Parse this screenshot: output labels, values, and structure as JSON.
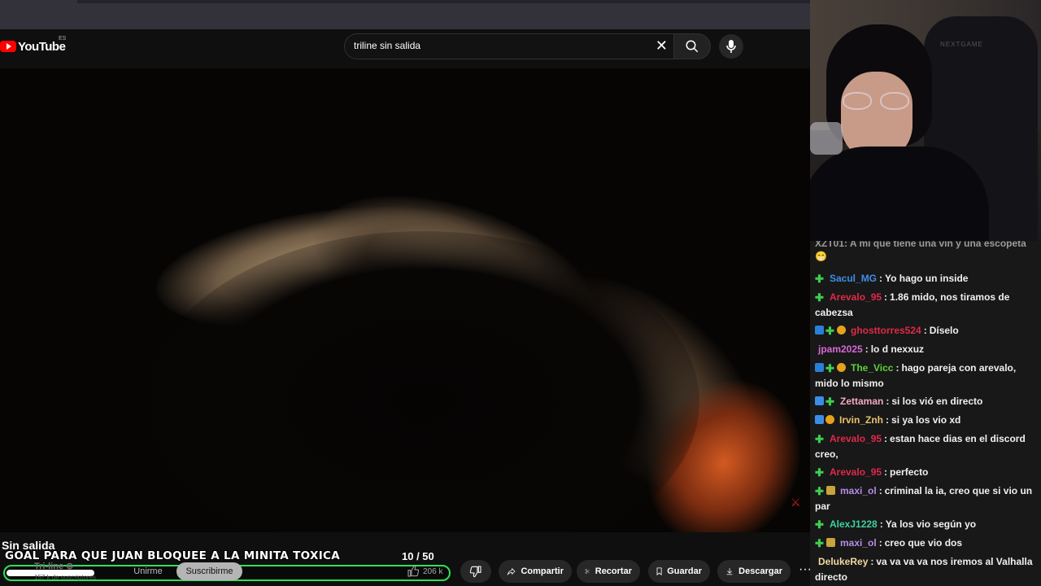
{
  "header": {
    "logo_text": "YouTube",
    "country_code": "ES",
    "search_value": "triline sin salida"
  },
  "video": {
    "title": "Sin salida"
  },
  "channel": {
    "name": "Tri-line ⊚",
    "subscribers": "157 k de suscriptores",
    "join_label": "Unirme",
    "subscribe_label": "Suscribirme"
  },
  "actions": {
    "likes": "206 k",
    "share": "Compartir",
    "clip": "Recortar",
    "save": "Guardar",
    "download": "Descargar",
    "more": "···"
  },
  "goal": {
    "text": "GOAL PARA QUE JUAN BLOQUEE A LA MINITA TOXICA",
    "count": "10 / 50",
    "current": 10,
    "target": 50
  },
  "webcam": {
    "chair_logo": "NEXTGAME"
  },
  "chat": {
    "cut_text": "XZT01: A mi que tiene una vin y una escopeta",
    "cut_emoji": "😁",
    "messages": [
      {
        "badges": [
          "plus"
        ],
        "user": "Sacul_MG",
        "color": "#3f8ee8",
        "text": "Yo hago un inside"
      },
      {
        "badges": [
          "plus"
        ],
        "user": "Arevalo_95",
        "color": "#e0294a",
        "text": "1.86 mido, nos tiramos de cabezsa"
      },
      {
        "badges": [
          "cube",
          "plus",
          "gold"
        ],
        "user": "ghosttorres524",
        "color": "#e0294a",
        "text": "Díselo"
      },
      {
        "badges": [],
        "user": "jpam2025",
        "color": "#d46ad8",
        "text": "lo d nexxuz"
      },
      {
        "badges": [
          "cube",
          "plus",
          "gold"
        ],
        "user": "The_Vicc",
        "color": "#5fd13a",
        "text": "hago pareja con arevalo, mido lo mismo"
      },
      {
        "badges": [
          "arrow",
          "plus"
        ],
        "user": "Zettaman",
        "color": "#f3a8c4",
        "text": "si los vió en directo"
      },
      {
        "badges": [
          "arrow",
          "gold"
        ],
        "user": "Irvin_Znh",
        "color": "#e8c36a",
        "text": "si ya los vio xd"
      },
      {
        "badges": [
          "plus"
        ],
        "user": "Arevalo_95",
        "color": "#e0294a",
        "text": "estan hace dias en el discord creo,"
      },
      {
        "badges": [
          "plus"
        ],
        "user": "Arevalo_95",
        "color": "#e0294a",
        "text": "perfecto"
      },
      {
        "badges": [
          "plus",
          "crown"
        ],
        "user": "maxi_ol",
        "color": "#b58ce8",
        "text": "criminal la ia, creo que si vio un par"
      },
      {
        "badges": [
          "plus"
        ],
        "user": "AlexJ1228",
        "color": "#3fd0a0",
        "text": "Ya los vio según yo"
      },
      {
        "badges": [
          "plus",
          "crown"
        ],
        "user": "maxi_ol",
        "color": "#b58ce8",
        "text": "creo que vio dos"
      },
      {
        "badges": [],
        "user": "DelukeRey",
        "color": "#f0d9a0",
        "text": "va va va va nos iremos al Valhalla directo"
      }
    ]
  }
}
